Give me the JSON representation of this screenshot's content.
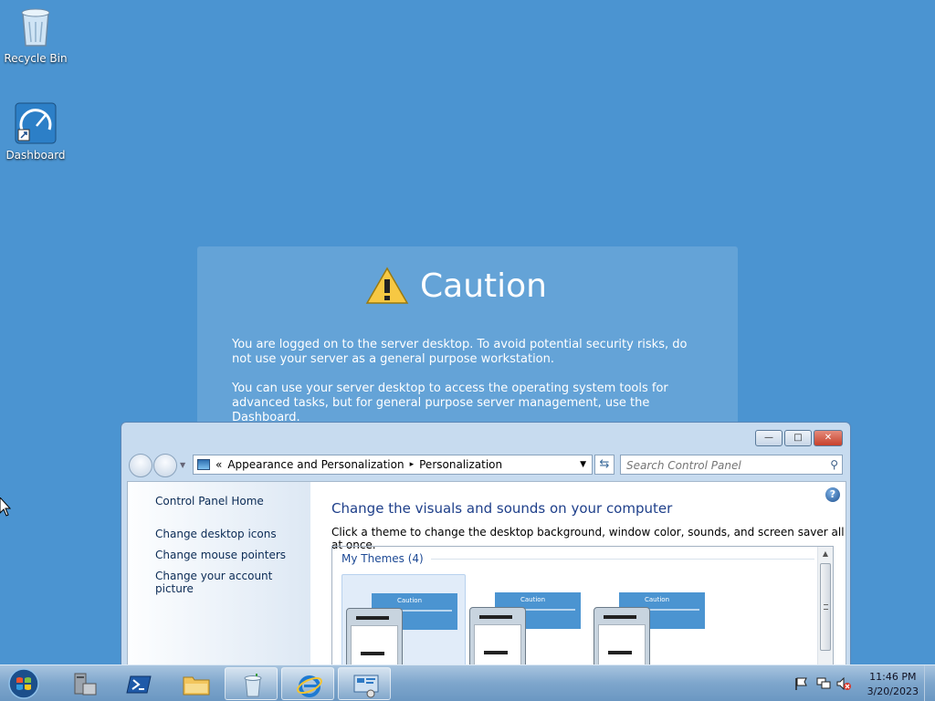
{
  "desktop": {
    "icons": [
      {
        "name": "recycle-bin",
        "label": "Recycle Bin"
      },
      {
        "name": "dashboard",
        "label": "Dashboard"
      }
    ],
    "caution": {
      "title": "Caution",
      "paragraph1": "You are logged on to the server desktop. To avoid potential security risks, do not use your server as a general purpose workstation.",
      "paragraph2": "You can use your server desktop to access the operating system tools for advanced tasks, but for general purpose server management, use the Dashboard."
    },
    "background_color": "#4b94d1"
  },
  "window": {
    "controls": {
      "minimize": "—",
      "maximize": "□",
      "close": "✕"
    },
    "address": {
      "chevron": "«",
      "crumbs": [
        "Appearance and Personalization",
        "Personalization"
      ],
      "separator": "▸"
    },
    "search": {
      "placeholder": "Search Control Panel"
    },
    "leftnav": {
      "home": "Control Panel Home",
      "links": [
        "Change desktop icons",
        "Change mouse pointers",
        "Change your account picture"
      ]
    },
    "main": {
      "heading": "Change the visuals and sounds on your computer",
      "description": "Click a theme to change the desktop background, window color, sounds, and screen saver all at once.",
      "themes_header": "My Themes (4)",
      "thumb_caption": "Caution",
      "themes_shown": 3,
      "selected_theme_index": 0
    }
  },
  "taskbar": {
    "apps": [
      {
        "name": "server-manager",
        "open": false
      },
      {
        "name": "powershell",
        "open": false
      },
      {
        "name": "file-explorer",
        "open": false
      },
      {
        "name": "recycle-app",
        "open": true
      },
      {
        "name": "internet-explorer",
        "open": true
      },
      {
        "name": "control-panel",
        "open": true
      }
    ],
    "clock": {
      "time": "11:46 PM",
      "date": "3/20/2023"
    },
    "tray_icons": [
      "action-center-flag-icon",
      "network-icon",
      "volume-muted-icon"
    ]
  }
}
